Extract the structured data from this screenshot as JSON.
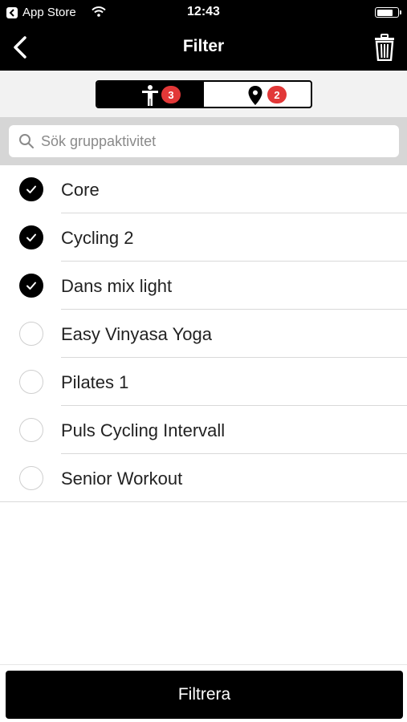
{
  "status_bar": {
    "back_app": "App Store",
    "time": "12:43",
    "battery_level": 0.75
  },
  "nav": {
    "title": "Filter"
  },
  "segments": [
    {
      "icon": "person-icon",
      "badge": "3",
      "active": true
    },
    {
      "icon": "location-pin-icon",
      "badge": "2",
      "active": false
    }
  ],
  "search": {
    "placeholder": "Sök gruppaktivitet",
    "value": ""
  },
  "activities": [
    {
      "label": "Core",
      "checked": true
    },
    {
      "label": "Cycling 2",
      "checked": true
    },
    {
      "label": "Dans mix light",
      "checked": true
    },
    {
      "label": "Easy Vinyasa Yoga",
      "checked": false
    },
    {
      "label": "Pilates 1",
      "checked": false
    },
    {
      "label": "Puls Cycling Intervall",
      "checked": false
    },
    {
      "label": "Senior Workout",
      "checked": false
    }
  ],
  "footer": {
    "button_label": "Filtrera"
  },
  "colors": {
    "bar": "#000000",
    "badge": "#e23838",
    "segment_bg": "#f2f2f2",
    "search_bg": "#d6d6d6"
  }
}
